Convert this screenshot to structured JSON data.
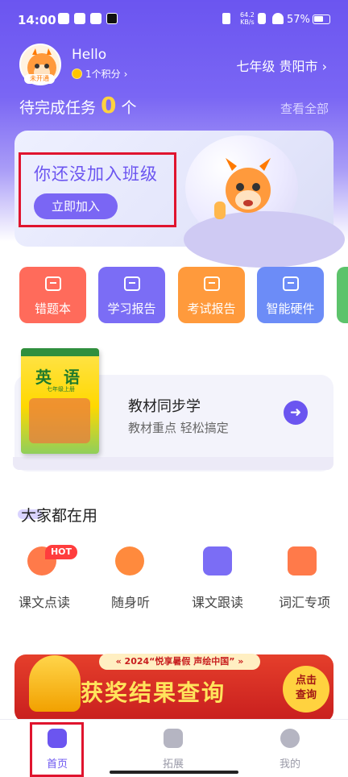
{
  "status_bar": {
    "time": "14:00",
    "net_speed_value": "64.2",
    "net_speed_unit": "KB/s",
    "battery": "57%"
  },
  "profile": {
    "avatar_tag": "未开通",
    "greeting": "Hello",
    "points": "1个积分",
    "points_chevron": "›",
    "grade_location": "七年级 贵阳市",
    "grade_chevron": "›"
  },
  "tasks": {
    "label": "待完成任务",
    "count": "0",
    "unit": "个",
    "view_all": "查看全部"
  },
  "class_card": {
    "title": "你还没加入班级",
    "join_button": "立即加入"
  },
  "quick_tiles": [
    {
      "label": "错题本",
      "color": "#ff6b5b"
    },
    {
      "label": "学习报告",
      "color": "#7b6df5"
    },
    {
      "label": "考试报告",
      "color": "#ff9a3c"
    },
    {
      "label": "智能硬件",
      "color": "#6c8cf7"
    }
  ],
  "textbook": {
    "cover_title": "英 语",
    "cover_subtitle": "七年级上册",
    "title": "教材同步学",
    "subtitle": "教材重点 轻松搞定",
    "arrow": "➜"
  },
  "section": {
    "title": "大家都在用"
  },
  "features": [
    {
      "label": "课文点读",
      "badge": "HOT",
      "color": "#ff7a4a"
    },
    {
      "label": "随身听",
      "color": "#ff8a3d"
    },
    {
      "label": "课文跟读",
      "color": "#7b6df5"
    },
    {
      "label": "词汇专项",
      "color": "#ff7a4a"
    }
  ],
  "banner": {
    "top_text": "« 2024“悦享暑假 声绘中国” »",
    "title": "获奖结果查询",
    "button_line1": "点击",
    "button_line2": "查询"
  },
  "tabbar": {
    "items": [
      {
        "label": "首页",
        "active": true
      },
      {
        "label": "拓展",
        "active": false
      },
      {
        "label": "我的",
        "active": false
      }
    ],
    "active_color": "#6b55f0",
    "inactive_color": "#9a9aa8"
  }
}
